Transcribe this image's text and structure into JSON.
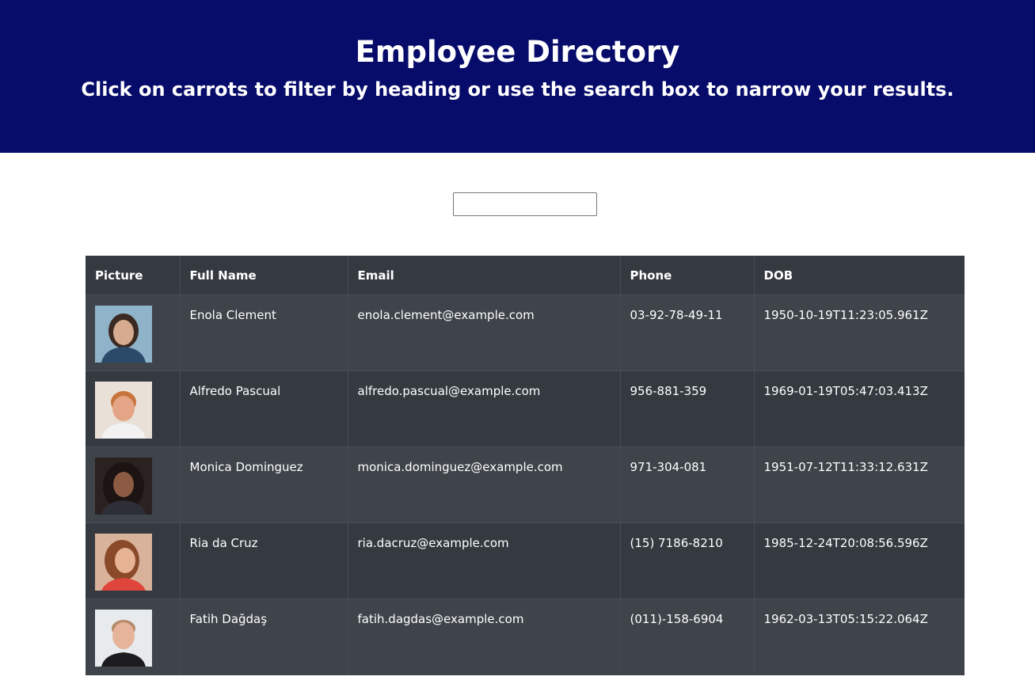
{
  "header": {
    "title": "Employee Directory",
    "subtitle": "Click on carrots to filter by heading or use the search box to narrow your results."
  },
  "search": {
    "value": "",
    "placeholder": ""
  },
  "table": {
    "columns": {
      "picture": "Picture",
      "name": "Full Name",
      "email": "Email",
      "phone": "Phone",
      "dob": "DOB"
    },
    "rows": [
      {
        "name": "Enola Clement",
        "email": "enola.clement@example.com",
        "phone": "03-92-78-49-11",
        "dob": "1950-10-19T11:23:05.961Z",
        "avatar": {
          "bg": "#8fb3c9",
          "skin": "#d6ab90",
          "hair": "#3a2a22",
          "shirt": "#2b4a6a"
        }
      },
      {
        "name": "Alfredo Pascual",
        "email": "alfredo.pascual@example.com",
        "phone": "956-881-359",
        "dob": "1969-01-19T05:47:03.413Z",
        "avatar": {
          "bg": "#e9e1d8",
          "skin": "#e3a585",
          "hair": "#c8743d",
          "shirt": "#f2f2f2"
        }
      },
      {
        "name": "Monica Dominguez",
        "email": "monica.dominguez@example.com",
        "phone": "971-304-081",
        "dob": "1951-07-12T11:33:12.631Z",
        "avatar": {
          "bg": "#2a2220",
          "skin": "#8d5a44",
          "hair": "#1b1412",
          "shirt": "#2e2e38"
        }
      },
      {
        "name": "Ria da Cruz",
        "email": "ria.dacruz@example.com",
        "phone": "(15) 7186-8210",
        "dob": "1985-12-24T20:08:56.596Z",
        "avatar": {
          "bg": "#d9b29b",
          "skin": "#e6b394",
          "hair": "#8a4a2a",
          "shirt": "#e0453c"
        }
      },
      {
        "name": "Fatih Dağdaş",
        "email": "fatih.dagdas@example.com",
        "phone": "(011)-158-6904",
        "dob": "1962-03-13T05:15:22.064Z",
        "avatar": {
          "bg": "#e8ebee",
          "skin": "#e6b49a",
          "hair": "#b58a6a",
          "shirt": "#1d1d1f"
        }
      }
    ]
  }
}
